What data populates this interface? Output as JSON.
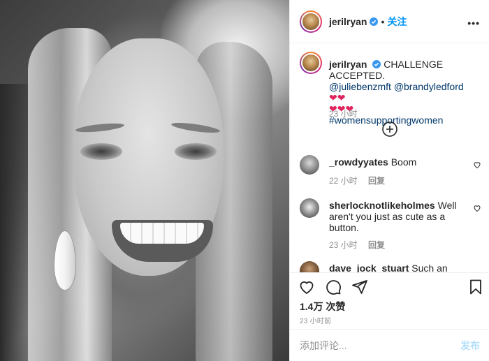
{
  "post": {
    "author": "jerilryan",
    "follow_label": "关注",
    "more_icon": "more-horizontal-icon",
    "caption": {
      "username": "jerilryan",
      "text": "CHALLENGE ACCEPTED.",
      "mentions": [
        "@juliebenzmft",
        "@brandyledford"
      ],
      "hashtag": "#womensupportingwomen",
      "time": "23 小时"
    },
    "load_more_icon": "plus-circle-icon",
    "comments": [
      {
        "username": "_rowdyyates",
        "text": "Boom",
        "time": "22 小时",
        "reply_label": "回复"
      },
      {
        "username": "sherlocknotlikeholmes",
        "text": "Well aren't you just as cute as a button.",
        "time": "23 小时",
        "reply_label": "回复"
      },
      {
        "username": "dave_jock_stuart",
        "text": "Such an"
      }
    ],
    "likes": "1.4万 次赞",
    "post_time": "23 小时前",
    "comment_input": {
      "placeholder": "添加评论...",
      "value": ""
    },
    "post_button": "发布",
    "colors": {
      "link": "#00376b",
      "follow": "#0095f6",
      "post_disabled": "#b2dffc",
      "heart": "#e0245e"
    }
  }
}
